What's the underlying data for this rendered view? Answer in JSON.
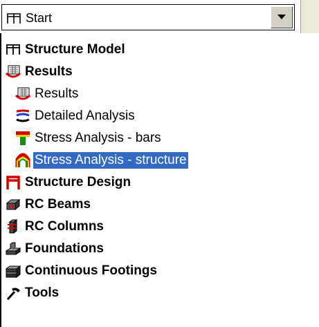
{
  "combo": {
    "value": "Start",
    "icon": "frame-icon",
    "dropdown_icon": "chevron-down-icon"
  },
  "tree": {
    "items": [
      {
        "label": "Structure Model",
        "icon": "frame-icon",
        "bold": true,
        "level": 0
      },
      {
        "label": "Results",
        "icon": "results-icon",
        "bold": true,
        "level": 0
      },
      {
        "label": "Results",
        "icon": "results-icon",
        "bold": false,
        "level": 1
      },
      {
        "label": "Detailed Analysis",
        "icon": "detailed-analysis-icon",
        "bold": false,
        "level": 1
      },
      {
        "label": "Stress Analysis - bars",
        "icon": "stress-bars-icon",
        "bold": false,
        "level": 1
      },
      {
        "label": "Stress Analysis - structure",
        "icon": "stress-structure-icon",
        "bold": false,
        "level": 1,
        "selected": true
      },
      {
        "label": "Structure Design",
        "icon": "structure-design-icon",
        "bold": true,
        "level": 0
      },
      {
        "label": "RC Beams",
        "icon": "rc-beams-icon",
        "bold": true,
        "level": 0
      },
      {
        "label": "RC Columns",
        "icon": "rc-columns-icon",
        "bold": true,
        "level": 0
      },
      {
        "label": "Foundations",
        "icon": "foundations-icon",
        "bold": true,
        "level": 0
      },
      {
        "label": "Continuous Footings",
        "icon": "continuous-footings-icon",
        "bold": true,
        "level": 0
      },
      {
        "label": "Tools",
        "icon": "tools-icon",
        "bold": true,
        "level": 0
      }
    ]
  },
  "colors": {
    "selection": "#316ac5",
    "accent_red": "#d40000",
    "button_face": "#d4d0c8"
  }
}
